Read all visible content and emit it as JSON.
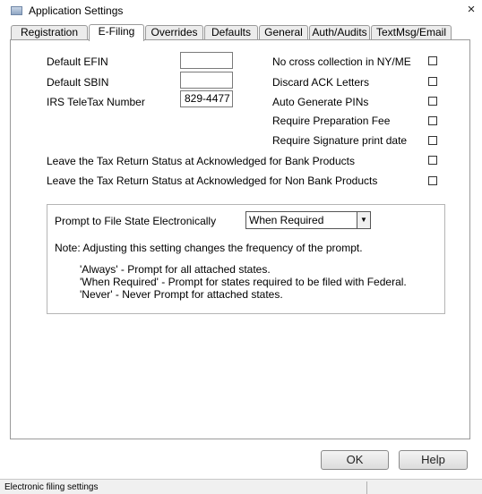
{
  "window": {
    "title": "Application Settings",
    "close": "×"
  },
  "tabs": [
    {
      "label": "Registration"
    },
    {
      "label": "E-Filing"
    },
    {
      "label": "Overrides"
    },
    {
      "label": "Defaults"
    },
    {
      "label": "General"
    },
    {
      "label": "Auth/Audits"
    },
    {
      "label": "TextMsg/Email"
    }
  ],
  "active_tab": "E-Filing",
  "fields": {
    "efin": {
      "label": "Default EFIN",
      "value": ""
    },
    "sbin": {
      "label": "Default SBIN",
      "value": ""
    },
    "teletax": {
      "label": "IRS TeleTax Number",
      "value": "829-4477"
    }
  },
  "options": [
    {
      "label": "No cross collection in NY/ME",
      "checked": false
    },
    {
      "label": "Discard ACK Letters",
      "checked": false
    },
    {
      "label": "Auto Generate PINs",
      "checked": false
    },
    {
      "label": "Require Preparation Fee",
      "checked": false
    },
    {
      "label": "Require Signature print date",
      "checked": false
    }
  ],
  "leave_status": [
    {
      "label": "Leave the Tax Return Status at Acknowledged for Bank Products",
      "checked": false
    },
    {
      "label": "Leave the Tax Return Status at Acknowledged for Non Bank Products",
      "checked": false
    }
  ],
  "state_prompt": {
    "label": "Prompt to File State Electronically",
    "selected": "When Required",
    "note": "Note: Adjusting this setting changes the frequency of the prompt.",
    "descriptions": [
      "'Always' - Prompt for all attached states.",
      "'When Required' - Prompt for states required to be filed with Federal.",
      "'Never' - Never Prompt for attached states."
    ]
  },
  "buttons": {
    "ok": "OK",
    "help": "Help"
  },
  "status": {
    "text": "Electronic filing settings"
  }
}
